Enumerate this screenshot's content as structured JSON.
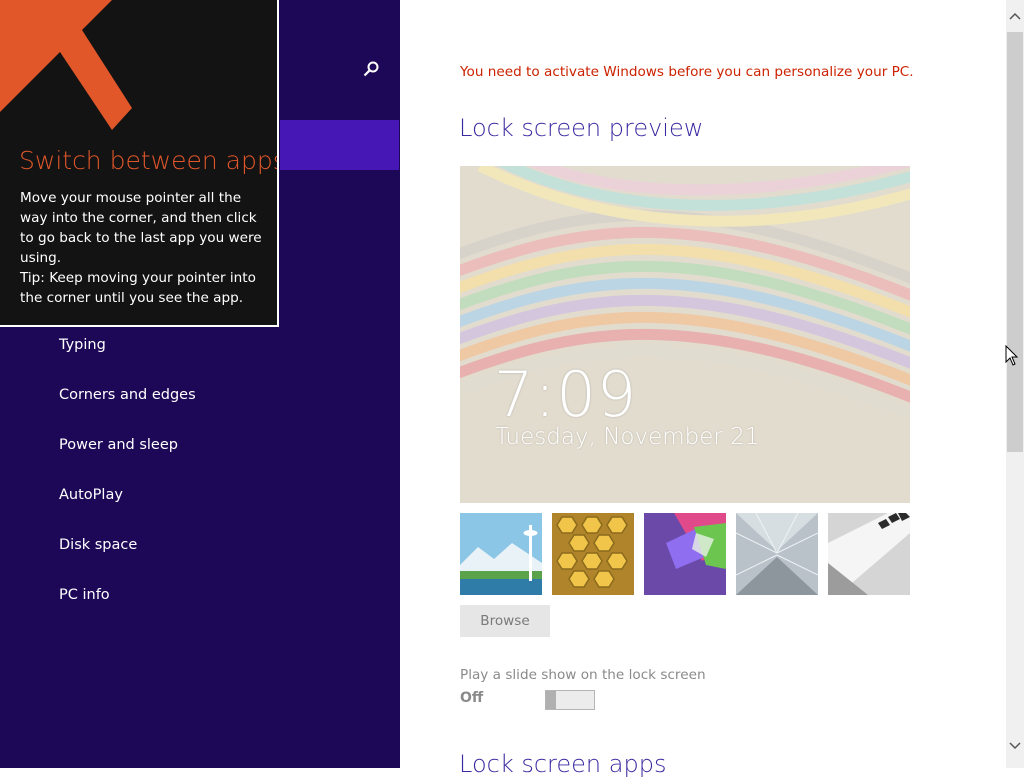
{
  "tip": {
    "title": "Switch between apps",
    "body_line1": "Move your mouse pointer all the way into the corner, and then click to go back to the last app you were using.",
    "body_line2": "Tip: Keep moving your pointer into the corner until you see the app.",
    "accent_color": "#e2572a"
  },
  "nav": {
    "background": "#1d0857",
    "selected_color": "#4617b4",
    "search_icon": "search-icon",
    "items": [
      {
        "label": "Typing"
      },
      {
        "label": "Corners and edges"
      },
      {
        "label": "Power and sleep"
      },
      {
        "label": "AutoPlay"
      },
      {
        "label": "Disk space"
      },
      {
        "label": "PC info"
      }
    ]
  },
  "main": {
    "activation_notice": "You need to activate Windows before you can personalize your PC.",
    "preview_title": "Lock screen preview",
    "preview": {
      "time": "7:09",
      "date": "Tuesday, November 21"
    },
    "thumbnails": [
      {
        "name": "space-needle"
      },
      {
        "name": "honeycomb"
      },
      {
        "name": "geometric-shapes"
      },
      {
        "name": "tunnel"
      },
      {
        "name": "piano-keys"
      }
    ],
    "browse_label": "Browse",
    "slideshow_label": "Play a slide show on the lock screen",
    "slideshow_state": "Off",
    "apps_title": "Lock screen apps"
  },
  "scrollbar": {
    "up_arrow": "chevron-up-icon",
    "down_arrow": "chevron-down-icon"
  }
}
